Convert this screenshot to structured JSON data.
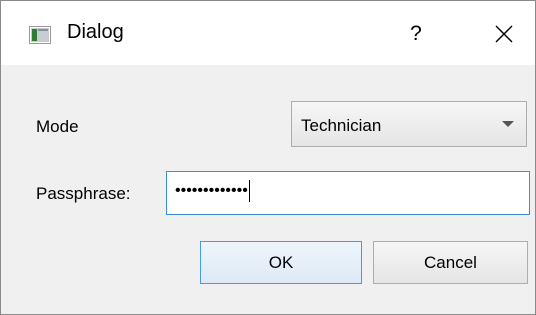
{
  "window": {
    "title": "Dialog",
    "help_label": "?",
    "icon": "window-app-icon",
    "close_icon": "close-icon"
  },
  "form": {
    "mode_label": "Mode",
    "mode_value": "Technician",
    "passphrase_label": "Passphrase:",
    "passphrase_value": "•••••••••••••"
  },
  "buttons": {
    "ok_label": "OK",
    "cancel_label": "Cancel"
  },
  "colors": {
    "focus_border": "#3c8ed9",
    "default_button_border": "#4a9ae0"
  }
}
